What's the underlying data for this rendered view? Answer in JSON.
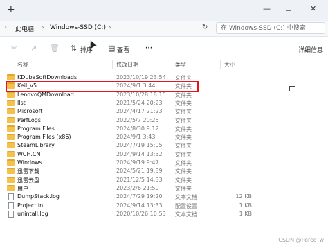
{
  "window": {
    "new_tab_glyph": "+",
    "minimize_glyph": "—",
    "maximize_glyph": "☐",
    "close_glyph": "✕"
  },
  "address": {
    "crumbs": [
      "此电脑",
      "Windows-SSD (C:)"
    ],
    "separator": "›",
    "search_placeholder": "在 Windows-SSD (C:) 中搜索"
  },
  "toolbar": {
    "sort_label": "排序",
    "view_label": "查看",
    "more_glyph": "···",
    "details_label": "详细信息"
  },
  "columns": {
    "name": "名称",
    "date": "修改日期",
    "type": "类型",
    "size": "大小"
  },
  "files": [
    {
      "name": "KDubaSoftDownloads",
      "date": "2023/10/19 23:54",
      "type": "文件夹",
      "size": "",
      "kind": "folder"
    },
    {
      "name": "Keil_v5",
      "date": "2024/9/1 3:44",
      "type": "文件夹",
      "size": "",
      "kind": "folder"
    },
    {
      "name": "LenovoQMDownload",
      "date": "2023/10/28 18:15",
      "type": "文件夹",
      "size": "",
      "kind": "folder"
    },
    {
      "name": "llst",
      "date": "2021/5/24 20:23",
      "type": "文件夹",
      "size": "",
      "kind": "folder"
    },
    {
      "name": "Microsoft",
      "date": "2024/4/17 21:23",
      "type": "文件夹",
      "size": "",
      "kind": "folder"
    },
    {
      "name": "PerfLogs",
      "date": "2022/5/7 20:25",
      "type": "文件夹",
      "size": "",
      "kind": "folder"
    },
    {
      "name": "Program Files",
      "date": "2024/8/30 9:12",
      "type": "文件夹",
      "size": "",
      "kind": "folder"
    },
    {
      "name": "Program Files (x86)",
      "date": "2024/9/1 3:43",
      "type": "文件夹",
      "size": "",
      "kind": "folder"
    },
    {
      "name": "SteamLibrary",
      "date": "2024/7/19 15:05",
      "type": "文件夹",
      "size": "",
      "kind": "folder"
    },
    {
      "name": "WCH.CN",
      "date": "2024/9/14 13:32",
      "type": "文件夹",
      "size": "",
      "kind": "folder"
    },
    {
      "name": "Windows",
      "date": "2024/9/19 9:47",
      "type": "文件夹",
      "size": "",
      "kind": "folder"
    },
    {
      "name": "迅雷下载",
      "date": "2024/5/21 19:39",
      "type": "文件夹",
      "size": "",
      "kind": "folder"
    },
    {
      "name": "迅雷云盘",
      "date": "2021/12/5 14:33",
      "type": "文件夹",
      "size": "",
      "kind": "folder"
    },
    {
      "name": "用户",
      "date": "2023/2/6 21:59",
      "type": "文件夹",
      "size": "",
      "kind": "folder"
    },
    {
      "name": "DumpStack.log",
      "date": "2024/7/29 19:20",
      "type": "文本文档",
      "size": "12 KB",
      "kind": "file"
    },
    {
      "name": "Project.ini",
      "date": "2024/9/14 13:33",
      "type": "配置设置",
      "size": "1 KB",
      "kind": "file"
    },
    {
      "name": "unintall.log",
      "date": "2020/10/26 10:53",
      "type": "文本文档",
      "size": "1 KB",
      "kind": "file"
    }
  ],
  "watermark": "CSDN @Porco_w",
  "colors": {
    "folder": "#f2c14e",
    "highlight": "#e8141c"
  }
}
